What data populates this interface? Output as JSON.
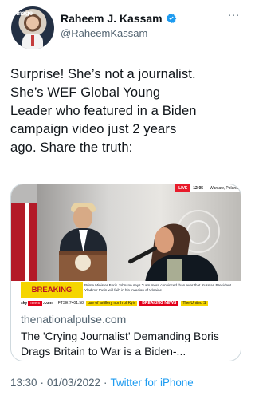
{
  "tweet": {
    "author_name": "Raheem J. Kassam",
    "handle": "@RaheemKassam",
    "text_lines": [
      "Surprise! She’s not a journalist.",
      "She’s WEF Global Young",
      "Leader who featured in a Biden",
      "campaign video just 2 years",
      "ago. Share the truth:"
    ],
    "time": "13:30",
    "date": "01/03/2022",
    "source": "Twitter for iPhone",
    "separator": "·",
    "menu_icon": "more-horizontal-icon",
    "verified_icon": "verified-badge-icon",
    "avatar_caption": "Image"
  },
  "card": {
    "domain": "thenationalpulse.com",
    "title": "The 'Crying Journalist' Demanding Boris Drags Britain to War is a Biden-...",
    "media": {
      "live_label": "LIVE",
      "time_label": "12:05",
      "location_label": "Warsaw, Poland",
      "breaking_label": "BREAKING NEWS",
      "breaking_text": "Prime Minister Boris Johnson says \"I am more convinced than ever that Russian President Vladimir Putin will fail\" in his invasion of Ukraine",
      "ticker": {
        "sky": "sky",
        "news": "news",
        "dotcom": ".com",
        "ftse": "FTSE 7401.58",
        "yellow_text": "use of artillery north of Kyiv",
        "red_text": "BREAKING NEWS",
        "end_text": "The United S"
      }
    }
  },
  "colors": {
    "text_primary": "#0f1419",
    "text_secondary": "#536471",
    "twitter_blue": "#1d9bf0",
    "card_border": "#cfd9de",
    "breaking_yellow": "#f5d500",
    "breaking_red": "#ba1225"
  }
}
